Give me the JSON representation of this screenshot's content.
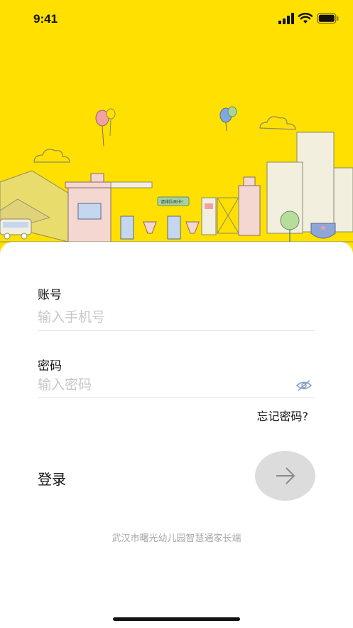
{
  "status_bar": {
    "time": "9:41",
    "icons": [
      "signal-icon",
      "wifi-icon",
      "battery-icon"
    ]
  },
  "hero": {
    "sign_text": "请排队刷卡！",
    "colors": {
      "background": "#FFE000",
      "mountain": "#E8DC6C",
      "building": "#F2EFDF",
      "gate": "#F4D7D0"
    }
  },
  "form": {
    "account": {
      "label": "账号",
      "placeholder": "输入手机号",
      "value": ""
    },
    "password": {
      "label": "密码",
      "placeholder": "输入密码",
      "value": ""
    },
    "forgot_label": "忘记密码?",
    "login_label": "登录"
  },
  "footer": {
    "text": "武汉市曙光幼儿园智慧通家长端"
  },
  "colors": {
    "accent": "#FFE000",
    "button": "#DCDCDC",
    "placeholder": "#C8C8C8"
  }
}
